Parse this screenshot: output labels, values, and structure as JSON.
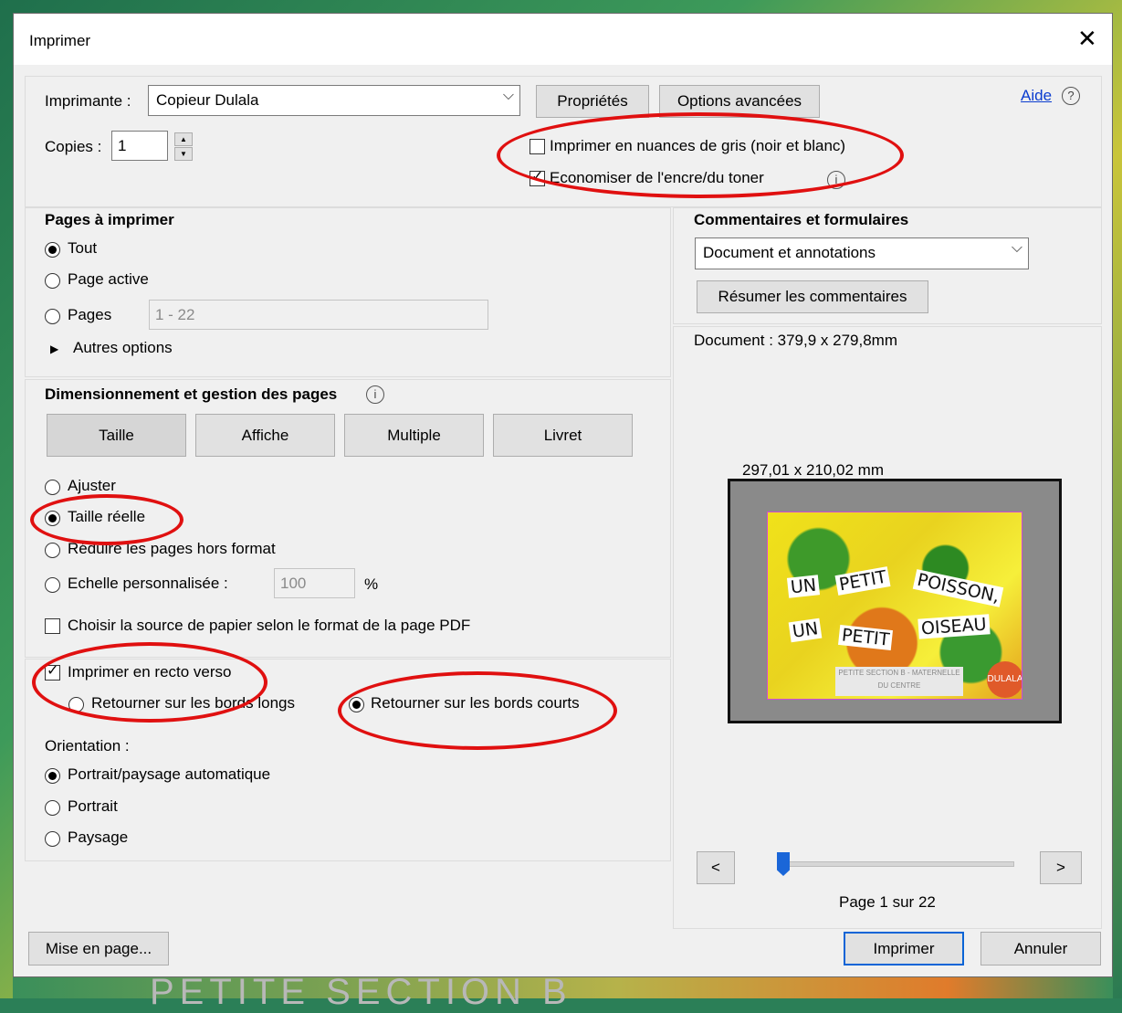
{
  "window": {
    "title": "Imprimer"
  },
  "top": {
    "printer_label": "Imprimante :",
    "printer_value": "Copieur Dulala",
    "properties_btn": "Propriétés",
    "advanced_btn": "Options avancées",
    "help_link": "Aide",
    "copies_label": "Copies :",
    "copies_value": "1",
    "grayscale_label": "Imprimer en nuances de gris (noir et blanc)",
    "grayscale_checked": false,
    "ink_label": "Economiser de l'encre/du toner",
    "ink_checked": true
  },
  "pages": {
    "heading": "Pages à imprimer",
    "all": "Tout",
    "current": "Page active",
    "pages": "Pages",
    "range_value": "1 - 22",
    "more": "Autres options"
  },
  "sizing": {
    "heading": "Dimensionnement et gestion des pages",
    "tab_size": "Taille",
    "tab_poster": "Affiche",
    "tab_multiple": "Multiple",
    "tab_booklet": "Livret",
    "fit": "Ajuster",
    "actual": "Taille réelle",
    "shrink": "Réduire les pages hors format",
    "custom": "Echelle personnalisée :",
    "scale_value": "100",
    "percent": "%",
    "paper_source": "Choisir la source de papier selon le format de la page PDF"
  },
  "duplex": {
    "label": "Imprimer en recto verso",
    "checked": true,
    "long_edge": "Retourner sur les bords longs",
    "short_edge": "Retourner sur les bords courts"
  },
  "orientation": {
    "heading": "Orientation :",
    "auto": "Portrait/paysage automatique",
    "portrait": "Portrait",
    "landscape": "Paysage"
  },
  "comments": {
    "heading": "Commentaires et formulaires",
    "value": "Document et annotations",
    "summarize_btn": "Résumer les commentaires"
  },
  "preview": {
    "doc_size": "Document : 379,9 x 279,8mm",
    "page_size": "297,01 x 210,02 mm",
    "words": [
      "UN",
      "PETIT",
      "POISSON,",
      "UN",
      "PETIT",
      "OISEAU"
    ],
    "tag_text": "PETITE SECTION B - MATERNELLE DU CENTRE",
    "logo": "DULALA",
    "prev_btn": "<",
    "next_btn": ">",
    "page_indicator": "Page 1 sur 22",
    "slider_position": 0
  },
  "footer": {
    "page_setup_btn": "Mise en page...",
    "print_btn": "Imprimer",
    "cancel_btn": "Annuler"
  },
  "background": {
    "text": "PETITE SECTION B"
  }
}
